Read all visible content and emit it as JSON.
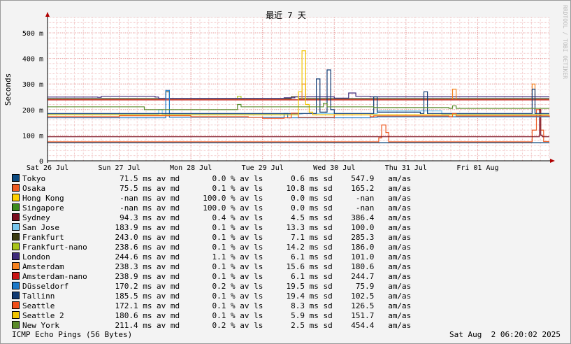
{
  "watermark": "RRDTOOL / TOBI OETIKER",
  "footer": {
    "left": "ICMP Echo Pings (56 Bytes)",
    "right": "Sat Aug  2 06:20:02 2025"
  },
  "chart_data": {
    "type": "line",
    "title": "最近 7 天",
    "ylabel": "Seconds",
    "xlabel": "",
    "ylim": [
      0,
      560
    ],
    "yticks": [
      {
        "value": 0,
        "label": "0"
      },
      {
        "value": 100,
        "label": "100 m"
      },
      {
        "value": 200,
        "label": "200 m"
      },
      {
        "value": 300,
        "label": "300 m"
      },
      {
        "value": 400,
        "label": "400 m"
      },
      {
        "value": 500,
        "label": "500 m"
      }
    ],
    "xlim": [
      0,
      7.0
    ],
    "xticks": [
      {
        "value": 0,
        "label": "Sat 26 Jul"
      },
      {
        "value": 1,
        "label": "Sun 27 Jul"
      },
      {
        "value": 2,
        "label": "Mon 28 Jul"
      },
      {
        "value": 3,
        "label": "Tue 29 Jul"
      },
      {
        "value": 4,
        "label": "Wed 30 Jul"
      },
      {
        "value": 5,
        "label": "Thu 31 Jul"
      },
      {
        "value": 6,
        "label": "Fri 01 Aug"
      }
    ],
    "grid": true,
    "series": [
      {
        "name": "Tokyo",
        "color": "#0c4a80",
        "avg": "71.5",
        "loss": "0.0",
        "sd": "0.6",
        "am": "547.9",
        "points": [
          [
            0,
            71
          ],
          [
            7.0,
            71
          ]
        ]
      },
      {
        "name": "Osaka",
        "color": "#ee5a22",
        "avg": "75.5",
        "loss": "0.1",
        "sd": "10.8",
        "am": "165.2",
        "points": [
          [
            0,
            74
          ],
          [
            4.6,
            74
          ],
          [
            4.62,
            90
          ],
          [
            4.66,
            140
          ],
          [
            4.72,
            110
          ],
          [
            4.76,
            74
          ],
          [
            6.7,
            74
          ],
          [
            6.76,
            120
          ],
          [
            6.82,
            200
          ],
          [
            6.88,
            120
          ],
          [
            6.92,
            75
          ],
          [
            7.0,
            75
          ]
        ]
      },
      {
        "name": "Hong Kong",
        "color": "#ffd100",
        "avg": "-nan",
        "loss": "100.0",
        "sd": "0.0",
        "am": "-nan",
        "points": []
      },
      {
        "name": "Singapore",
        "color": "#3c8c1e",
        "avg": "-nan",
        "loss": "100.0",
        "sd": "0.0",
        "am": "-nan",
        "points": []
      },
      {
        "name": "Sydney",
        "color": "#7a0d1e",
        "avg": "94.3",
        "loss": "0.4",
        "sd": "4.5",
        "am": "386.4",
        "points": [
          [
            0,
            94
          ],
          [
            6.84,
            94
          ],
          [
            6.86,
            200
          ],
          [
            6.88,
            100
          ],
          [
            6.9,
            94
          ],
          [
            7.0,
            94
          ]
        ]
      },
      {
        "name": "San Jose",
        "color": "#76c6ee",
        "avg": "183.9",
        "loss": "0.1",
        "sd": "13.3",
        "am": "100.0",
        "points": [
          [
            0,
            183
          ],
          [
            1.5,
            183
          ],
          [
            1.55,
            200
          ],
          [
            1.6,
            183
          ],
          [
            3.3,
            183
          ],
          [
            3.55,
            185
          ],
          [
            4.5,
            184
          ],
          [
            4.6,
            195
          ],
          [
            5.5,
            182
          ],
          [
            7.0,
            182
          ]
        ]
      },
      {
        "name": "Frankfurt",
        "color": "#3a3a10",
        "avg": "243.0",
        "loss": "0.1",
        "sd": "7.1",
        "am": "285.3",
        "points": [
          [
            0,
            243
          ],
          [
            1.6,
            243
          ],
          [
            1.65,
            270
          ],
          [
            1.7,
            243
          ],
          [
            3.3,
            243
          ],
          [
            3.4,
            250
          ],
          [
            3.5,
            243
          ],
          [
            7.0,
            243
          ]
        ]
      },
      {
        "name": "Frankfurt-nano",
        "color": "#a8c418",
        "avg": "238.6",
        "loss": "0.1",
        "sd": "14.2",
        "am": "186.0",
        "points": [
          [
            0,
            238
          ],
          [
            2.6,
            238
          ],
          [
            2.65,
            252
          ],
          [
            2.7,
            238
          ],
          [
            4.5,
            238
          ],
          [
            7.0,
            238
          ]
        ]
      },
      {
        "name": "London",
        "color": "#3e2a7a",
        "avg": "244.6",
        "loss": "1.1",
        "sd": "6.1",
        "am": "101.0",
        "points": [
          [
            0,
            249
          ],
          [
            0.7,
            248
          ],
          [
            0.75,
            252
          ],
          [
            1.5,
            249
          ],
          [
            1.55,
            244
          ],
          [
            3.3,
            246
          ],
          [
            3.45,
            250
          ],
          [
            4.0,
            245
          ],
          [
            4.2,
            265
          ],
          [
            4.3,
            252
          ],
          [
            4.5,
            250
          ],
          [
            6.2,
            250
          ],
          [
            7.0,
            250
          ]
        ]
      },
      {
        "name": "Amsterdam",
        "color": "#f58220",
        "avg": "238.3",
        "loss": "0.1",
        "sd": "15.6",
        "am": "180.6",
        "points": [
          [
            0,
            238
          ],
          [
            3.5,
            238
          ],
          [
            3.55,
            300
          ],
          [
            3.6,
            238
          ],
          [
            5.6,
            238
          ],
          [
            5.65,
            280
          ],
          [
            5.7,
            238
          ],
          [
            6.7,
            238
          ],
          [
            6.76,
            300
          ],
          [
            6.8,
            238
          ],
          [
            7.0,
            238
          ]
        ]
      },
      {
        "name": "Amsterdam-nano",
        "color": "#c81414",
        "avg": "238.9",
        "loss": "0.1",
        "sd": "6.1",
        "am": "244.7",
        "points": [
          [
            0,
            238
          ],
          [
            7.0,
            238
          ]
        ]
      },
      {
        "name": "Düsseldorf",
        "color": "#1b79c9",
        "avg": "170.2",
        "loss": "0.2",
        "sd": "19.5",
        "am": "75.9",
        "points": [
          [
            0,
            168
          ],
          [
            1.6,
            168
          ],
          [
            1.65,
            275
          ],
          [
            1.7,
            170
          ],
          [
            3.2,
            170
          ],
          [
            3.3,
            185
          ],
          [
            3.35,
            168
          ],
          [
            4.5,
            170
          ],
          [
            4.6,
            172
          ],
          [
            7.0,
            170
          ]
        ]
      },
      {
        "name": "Tallinn",
        "color": "#103a72",
        "avg": "185.5",
        "loss": "0.1",
        "sd": "19.4",
        "am": "102.5",
        "points": [
          [
            0,
            185
          ],
          [
            3.7,
            185
          ],
          [
            3.75,
            320
          ],
          [
            3.8,
            190
          ],
          [
            3.9,
            355
          ],
          [
            3.95,
            200
          ],
          [
            4.0,
            185
          ],
          [
            4.5,
            185
          ],
          [
            4.55,
            250
          ],
          [
            4.6,
            190
          ],
          [
            5.2,
            185
          ],
          [
            5.25,
            270
          ],
          [
            5.3,
            185
          ],
          [
            6.7,
            185
          ],
          [
            6.76,
            280
          ],
          [
            6.8,
            185
          ],
          [
            7.0,
            185
          ]
        ]
      },
      {
        "name": "Seattle",
        "color": "#f04e1a",
        "avg": "172.1",
        "loss": "0.1",
        "sd": "8.3",
        "am": "126.5",
        "points": [
          [
            0,
            172
          ],
          [
            1.0,
            176
          ],
          [
            2.0,
            172
          ],
          [
            2.8,
            170
          ],
          [
            3.0,
            166
          ],
          [
            3.3,
            168
          ],
          [
            3.4,
            186
          ],
          [
            3.5,
            170
          ],
          [
            4.0,
            180
          ],
          [
            4.5,
            172
          ],
          [
            4.55,
            175
          ],
          [
            5.6,
            172
          ],
          [
            5.65,
            185
          ],
          [
            5.7,
            175
          ],
          [
            7.0,
            172
          ]
        ]
      },
      {
        "name": "Seattle 2",
        "color": "#f0c400",
        "avg": "180.6",
        "loss": "0.1",
        "sd": "5.9",
        "am": "151.7",
        "points": [
          [
            0,
            180
          ],
          [
            3.4,
            180
          ],
          [
            3.5,
            270
          ],
          [
            3.55,
            430
          ],
          [
            3.6,
            220
          ],
          [
            3.65,
            190
          ],
          [
            3.7,
            180
          ],
          [
            4.5,
            180
          ],
          [
            7.0,
            180
          ]
        ]
      },
      {
        "name": "New York",
        "color": "#5a8a28",
        "avg": "211.4",
        "loss": "0.2",
        "sd": "2.5",
        "am": "454.4",
        "points": [
          [
            0,
            211
          ],
          [
            1.3,
            211
          ],
          [
            1.35,
            200
          ],
          [
            2.6,
            200
          ],
          [
            2.65,
            220
          ],
          [
            2.7,
            211
          ],
          [
            3.8,
            211
          ],
          [
            3.85,
            225
          ],
          [
            3.9,
            211
          ],
          [
            4.5,
            211
          ],
          [
            4.55,
            208
          ],
          [
            5.6,
            205
          ],
          [
            5.65,
            215
          ],
          [
            5.7,
            205
          ],
          [
            7.0,
            205
          ]
        ]
      }
    ]
  }
}
